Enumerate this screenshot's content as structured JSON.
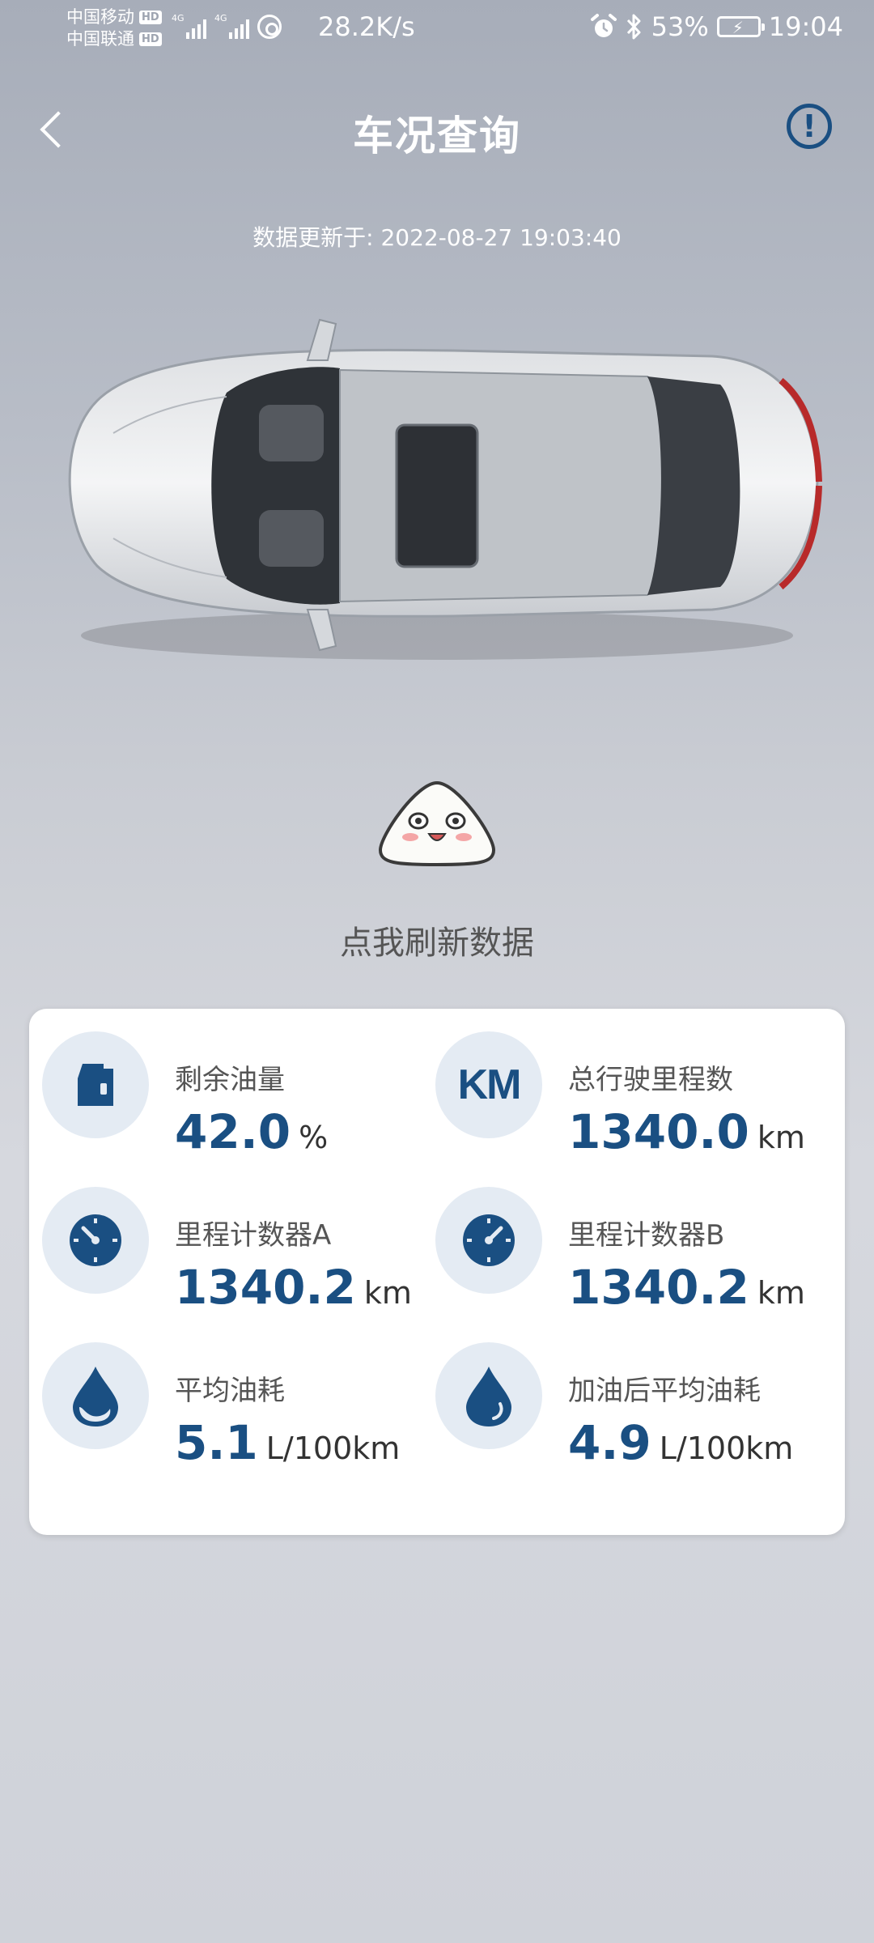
{
  "status_bar": {
    "carrier1": "中国移动",
    "carrier2": "中国联通",
    "hd": "HD",
    "net_type1": "4G",
    "net_type2": "4G",
    "net_speed": "28.2K/s",
    "battery": "53%",
    "time": "19:04"
  },
  "header": {
    "title": "车况查询",
    "back_icon": "chevron-left-icon",
    "info_icon": "exclamation-circle-icon"
  },
  "updated_text": "数据更新于: 2022-08-27 19:03:40",
  "refresh_label": "点我刷新数据",
  "accent_color": "#1a4f82",
  "stats": [
    {
      "label": "剩余油量",
      "value": "42.0",
      "unit": "%",
      "icon": "fuel-can-icon"
    },
    {
      "label": "总行驶里程数",
      "value": "1340.0",
      "unit": "km",
      "icon": "km-icon"
    },
    {
      "label": "里程计数器A",
      "value": "1340.2",
      "unit": "km",
      "icon": "gauge-icon"
    },
    {
      "label": "里程计数器B",
      "value": "1340.2",
      "unit": "km",
      "icon": "gauge-icon"
    },
    {
      "label": "平均油耗",
      "value": "5.1",
      "unit": "L/100km",
      "icon": "fuel-drop-icon"
    },
    {
      "label": "加油后平均油耗",
      "value": "4.9",
      "unit": "L/100km",
      "icon": "fuel-drop-icon"
    }
  ]
}
